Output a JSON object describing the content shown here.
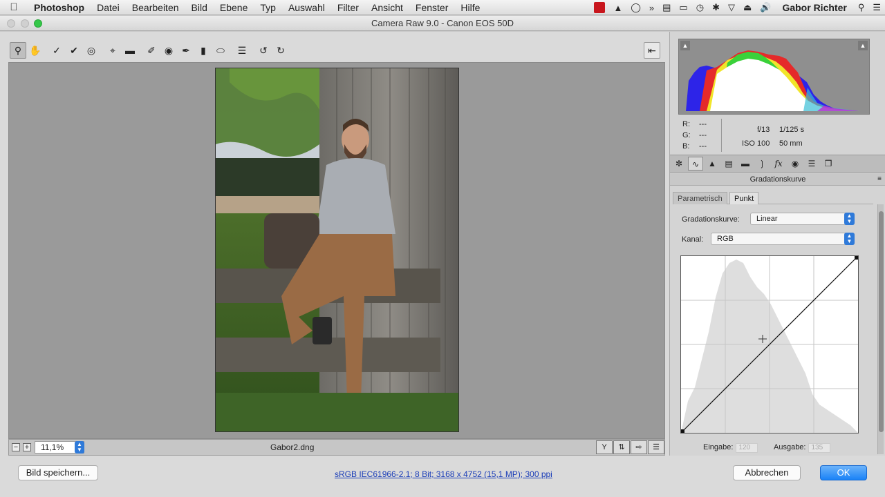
{
  "menubar": {
    "app": "Photoshop",
    "items": [
      "Datei",
      "Bearbeiten",
      "Bild",
      "Ebene",
      "Typ",
      "Auswahl",
      "Filter",
      "Ansicht",
      "Fenster",
      "Hilfe"
    ],
    "user": "Gabor Richter",
    "status_icons": [
      "adobe-creative-cloud-icon",
      "hat-icon",
      "cc-icon",
      "forward-icon",
      "drive-icon",
      "airplay-icon",
      "time-machine-icon",
      "bluetooth-icon",
      "wifi-icon",
      "eject-icon",
      "volume-icon",
      "search-icon",
      "list-icon"
    ]
  },
  "window": {
    "title": "Camera Raw 9.0  -  Canon EOS 50D"
  },
  "toolbar": {
    "tools": [
      {
        "name": "zoom-tool",
        "glyph": "🔍",
        "active": true
      },
      {
        "name": "hand-tool",
        "glyph": "✋"
      },
      {
        "name": "white-balance-tool",
        "glyph": "⟋"
      },
      {
        "name": "color-sampler-tool",
        "glyph": "⟋"
      },
      {
        "name": "targeted-adjustment-tool",
        "glyph": "◎"
      },
      {
        "name": "crop-tool",
        "glyph": "⌗"
      },
      {
        "name": "straighten-tool",
        "glyph": "▭"
      },
      {
        "name": "spot-removal-tool",
        "glyph": "✎"
      },
      {
        "name": "red-eye-tool",
        "glyph": "◉"
      },
      {
        "name": "adjustment-brush-tool",
        "glyph": "✐"
      },
      {
        "name": "graduated-filter-tool",
        "glyph": "▮"
      },
      {
        "name": "radial-filter-tool",
        "glyph": "◯"
      },
      {
        "name": "preferences-tool",
        "glyph": "☰"
      },
      {
        "name": "rotate-left-tool",
        "glyph": "↺"
      },
      {
        "name": "rotate-right-tool",
        "glyph": "↻"
      }
    ],
    "open_image_icon": "⎘"
  },
  "statusbar": {
    "zoom_value": "11,1%",
    "filename": "Gabor2.dng"
  },
  "readout": {
    "r_label": "R:",
    "r_value": "---",
    "g_label": "G:",
    "g_value": "---",
    "b_label": "B:",
    "b_value": "---",
    "aperture": "f/13",
    "shutter": "1/125 s",
    "iso": "ISO 100",
    "focal": "50 mm"
  },
  "panel": {
    "title": "Gradationskurve",
    "subtabs": [
      "Parametrisch",
      "Punkt"
    ],
    "curve_label": "Gradationskurve:",
    "curve_value": "Linear",
    "channel_label": "Kanal:",
    "channel_value": "RGB",
    "input_label": "Eingabe:",
    "input_value": "120",
    "output_label": "Ausgabe:",
    "output_value": "135"
  },
  "bottom": {
    "save_label": "Bild speichern...",
    "workflow_link": "sRGB IEC61966-2.1; 8 Bit; 3168 x 4752 (15,1 MP); 300 ppi",
    "cancel_label": "Abbrechen",
    "ok_label": "OK"
  }
}
